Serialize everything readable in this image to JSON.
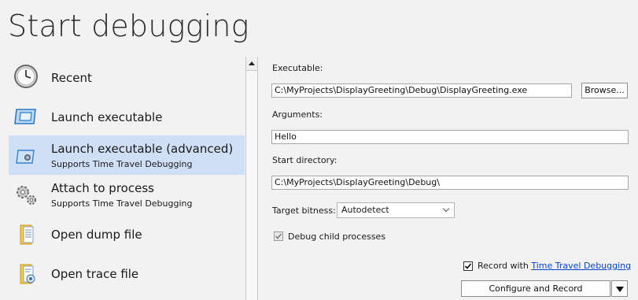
{
  "page": {
    "title": "Start debugging"
  },
  "nav": {
    "items": [
      {
        "label": "Recent",
        "sub": ""
      },
      {
        "label": "Launch executable",
        "sub": ""
      },
      {
        "label": "Launch executable (advanced)",
        "sub": "Supports Time Travel Debugging"
      },
      {
        "label": "Attach to process",
        "sub": "Supports Time Travel Debugging"
      },
      {
        "label": "Open dump file",
        "sub": ""
      },
      {
        "label": "Open trace file",
        "sub": ""
      }
    ],
    "selected_index": 2
  },
  "form": {
    "executable_label": "Executable:",
    "executable_value": "C:\\MyProjects\\DisplayGreeting\\Debug\\DisplayGreeting.exe",
    "browse_label": "Browse...",
    "arguments_label": "Arguments:",
    "arguments_value": "Hello",
    "start_dir_label": "Start directory:",
    "start_dir_value": "C:\\MyProjects\\DisplayGreeting\\Debug\\",
    "bitness_label": "Target bitness:",
    "bitness_value": "Autodetect",
    "debug_child_label": "Debug child processes",
    "debug_child_checked": true,
    "record_prefix": "Record with ",
    "record_link": "Time Travel Debugging",
    "record_checked": true,
    "configure_button": "Configure and Record"
  },
  "colors": {
    "selection": "#cfe0f6",
    "link": "#0645c8",
    "background": "#f2f2f2"
  }
}
